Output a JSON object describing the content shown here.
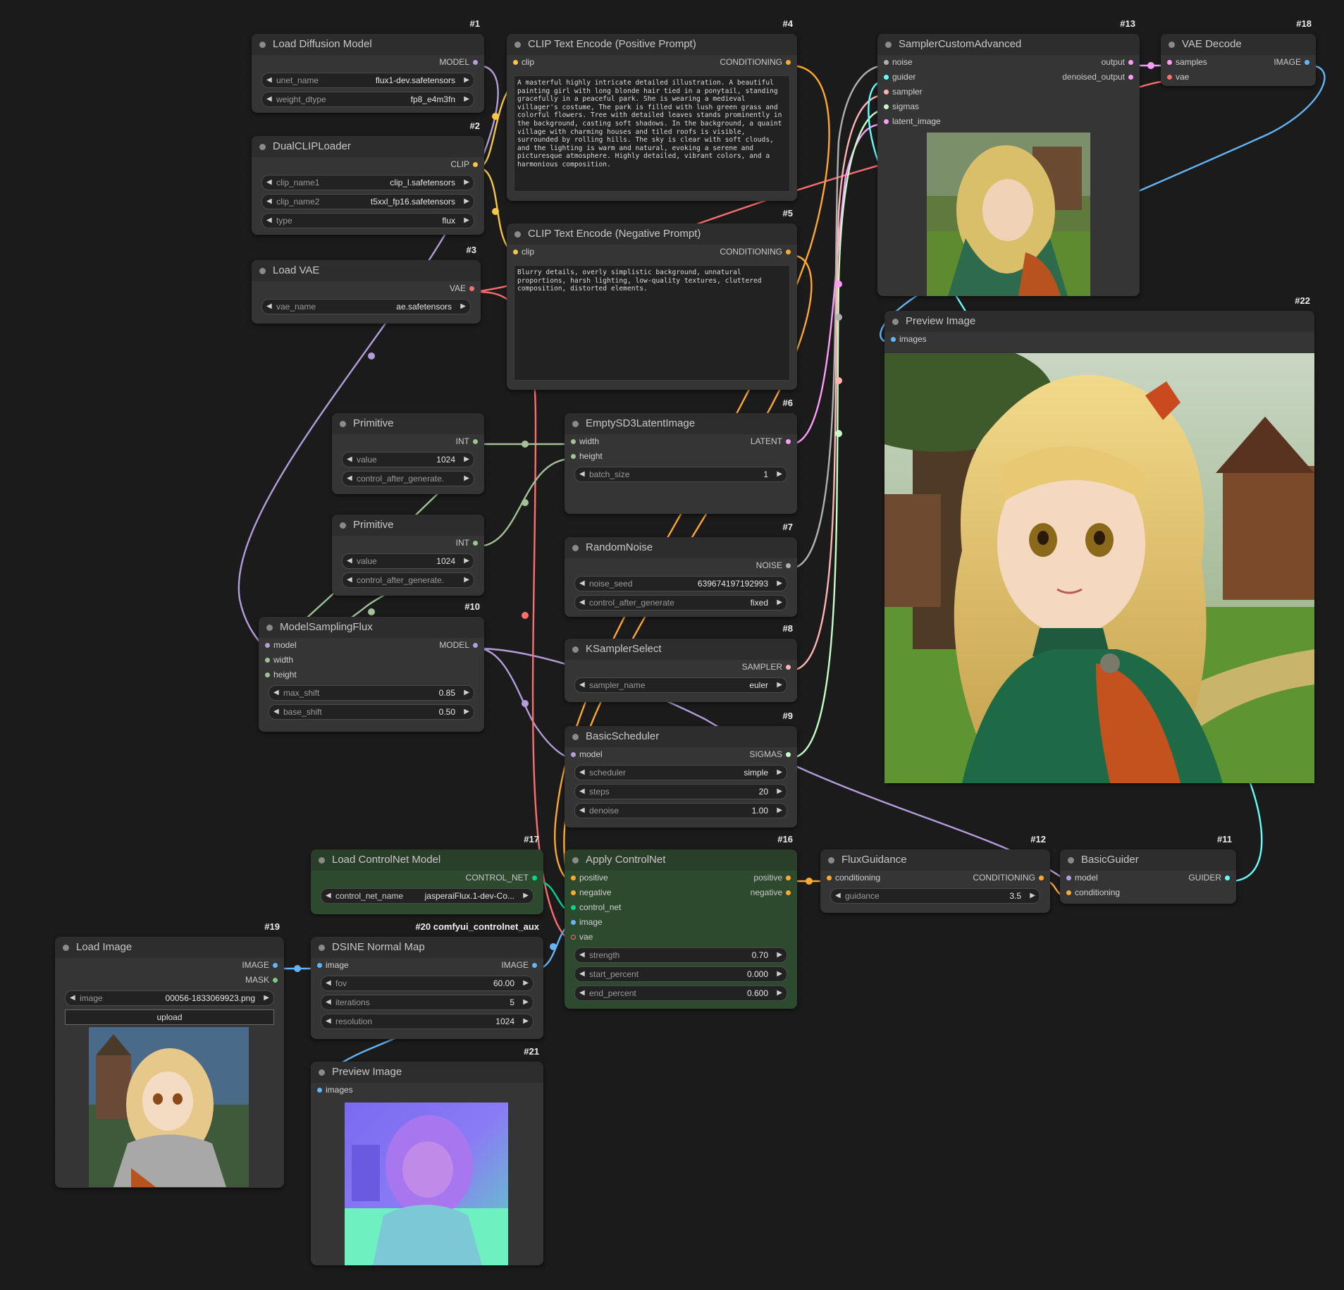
{
  "colors": {
    "model": "#b39ddb",
    "clip": "#f6c744",
    "vae": "#ff6e6e",
    "conditioning": "#ffa931",
    "latent": "#ff9cf9",
    "int": "#a1c196",
    "noise": "#b0b0b0",
    "sampler": "#ffb4b4",
    "sigmas": "#c6ffc6",
    "guider": "#66ffff",
    "image": "#64b5f6",
    "mask": "#81c784",
    "control_net": "#00d78d",
    "guider_link": "#33ddff"
  },
  "nodes": {
    "n1": {
      "id": "#1",
      "title": "Load Diffusion Model",
      "out": "MODEL",
      "w1_name": "unet_name",
      "w1_val": "flux1-dev.safetensors",
      "w2_name": "weight_dtype",
      "w2_val": "fp8_e4m3fn"
    },
    "n2": {
      "id": "#2",
      "title": "DualCLIPLoader",
      "out": "CLIP",
      "w1_name": "clip_name1",
      "w1_val": "clip_l.safetensors",
      "w2_name": "clip_name2",
      "w2_val": "t5xxl_fp16.safetensors",
      "w3_name": "type",
      "w3_val": "flux"
    },
    "n3": {
      "id": "#3",
      "title": "Load VAE",
      "out": "VAE",
      "w1_name": "vae_name",
      "w1_val": "ae.safetensors"
    },
    "n4": {
      "id": "#4",
      "title": "CLIP Text Encode (Positive Prompt)",
      "in": "clip",
      "out": "CONDITIONING",
      "text": "A masterful highly intricate detailed illustration. A beautiful painting girl with long blonde hair tied in a ponytail, standing gracefully in a peaceful park. She is wearing a medieval villager's costume, The park is filled with lush green grass and colorful flowers. Tree with detailed leaves stands prominently in the background, casting soft shadows. In the background, a quaint village with charming houses and tiled roofs is visible, surrounded by rolling hills. The sky is clear with soft clouds, and the lighting is warm and natural, evoking a serene and picturesque atmosphere. Highly detailed, vibrant colors, and a harmonious composition."
    },
    "n5": {
      "id": "#5",
      "title": "CLIP Text Encode (Negative Prompt)",
      "in": "clip",
      "out": "CONDITIONING",
      "text": "Blurry details, overly simplistic background, unnatural proportions, harsh lighting, low-quality textures, cluttered composition, distorted elements."
    },
    "n6": {
      "id": "#6",
      "title": "EmptySD3LatentImage",
      "in1": "width",
      "in2": "height",
      "out": "LATENT",
      "w1_name": "batch_size",
      "w1_val": "1"
    },
    "n7": {
      "id": "#7",
      "title": "RandomNoise",
      "out": "NOISE",
      "w1_name": "noise_seed",
      "w1_val": "639674197192993",
      "w2_name": "control_after_generate",
      "w2_val": "fixed"
    },
    "n8": {
      "id": "#8",
      "title": "KSamplerSelect",
      "out": "SAMPLER",
      "w1_name": "sampler_name",
      "w1_val": "euler"
    },
    "n9": {
      "id": "#9",
      "title": "BasicScheduler",
      "in": "model",
      "out": "SIGMAS",
      "w1_name": "scheduler",
      "w1_val": "simple",
      "w2_name": "steps",
      "w2_val": "20",
      "w3_name": "denoise",
      "w3_val": "1.00"
    },
    "n10": {
      "id": "#10",
      "title": "ModelSamplingFlux",
      "in1": "model",
      "in2": "width",
      "in3": "height",
      "out": "MODEL",
      "w1_name": "max_shift",
      "w1_val": "0.85",
      "w2_name": "base_shift",
      "w2_val": "0.50"
    },
    "n11": {
      "id": "#11",
      "title": "BasicGuider",
      "in1": "model",
      "in2": "conditioning",
      "out": "GUIDER"
    },
    "n12": {
      "id": "#12",
      "title": "FluxGuidance",
      "in": "conditioning",
      "out": "CONDITIONING",
      "w1_name": "guidance",
      "w1_val": "3.5"
    },
    "n13": {
      "id": "#13",
      "title": "SamplerCustomAdvanced",
      "in1": "noise",
      "in2": "guider",
      "in3": "sampler",
      "in4": "sigmas",
      "in5": "latent_image",
      "out1": "output",
      "out2": "denoised_output"
    },
    "n16": {
      "id": "#16",
      "title": "Apply ControlNet",
      "in1": "positive",
      "in2": "negative",
      "in3": "control_net",
      "in4": "image",
      "in5": "vae",
      "out1": "positive",
      "out2": "negative",
      "w1_name": "strength",
      "w1_val": "0.70",
      "w2_name": "start_percent",
      "w2_val": "0.000",
      "w3_name": "end_percent",
      "w3_val": "0.600"
    },
    "n17": {
      "id": "#17",
      "title": "Load ControlNet Model",
      "out": "CONTROL_NET",
      "w1_name": "control_net_name",
      "w1_val": "jasperaiFlux.1-dev-Co..."
    },
    "n18": {
      "id": "#18",
      "title": "VAE Decode",
      "in1": "samples",
      "in2": "vae",
      "out": "IMAGE"
    },
    "n19": {
      "id": "#19",
      "title": "Load Image",
      "out1": "IMAGE",
      "out2": "MASK",
      "w1_name": "image",
      "w1_val": "00056-1833069923.png",
      "upload": "upload"
    },
    "n20": {
      "id": "#20 comfyui_controlnet_aux",
      "title": "DSINE Normal Map",
      "in": "image",
      "out": "IMAGE",
      "w1_name": "fov",
      "w1_val": "60.00",
      "w2_name": "iterations",
      "w2_val": "5",
      "w3_name": "resolution",
      "w3_val": "1024"
    },
    "n21": {
      "id": "#21",
      "title": "Preview Image",
      "in": "images"
    },
    "n22": {
      "id": "#22",
      "title": "Preview Image",
      "in": "images"
    },
    "p1": {
      "title": "Primitive",
      "out": "INT",
      "w1_name": "value",
      "w1_val": "1024",
      "w2_name": "control_after_generate.",
      "w2_val": ""
    },
    "p2": {
      "title": "Primitive",
      "out": "INT",
      "w1_name": "value",
      "w1_val": "1024",
      "w2_name": "control_after_generate.",
      "w2_val": ""
    }
  }
}
